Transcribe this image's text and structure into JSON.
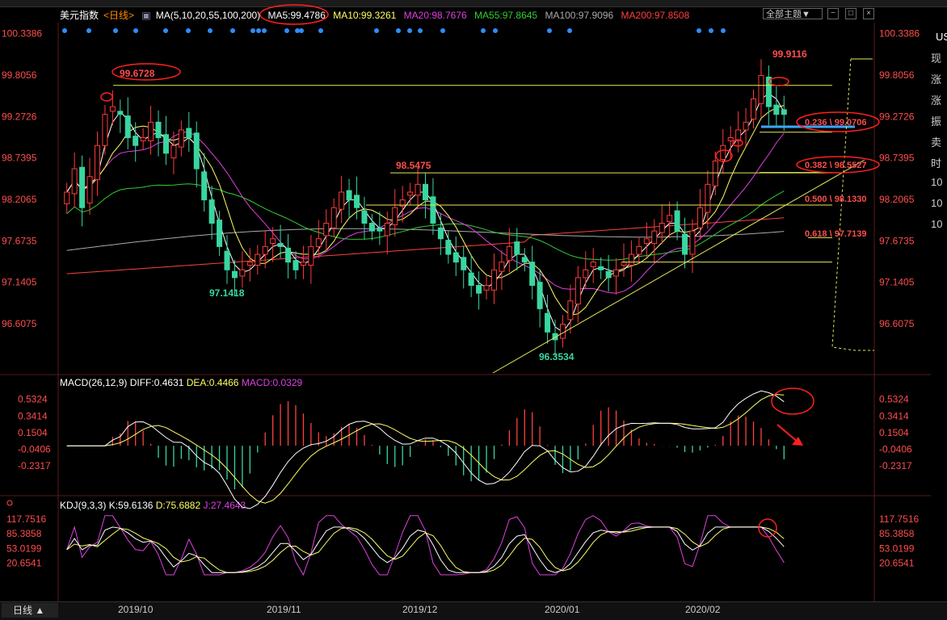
{
  "header": {
    "title": "美元指数",
    "period": "<日线>",
    "ma_label": "MA(5,10,20,55,100,200)",
    "ma5": "MA5:99.4786",
    "ma10": "MA10:99.3261",
    "ma20": "MA20:98.7676",
    "ma55": "MA55:97.8645",
    "ma100": "MA100:97.9096",
    "ma200": "MA200:97.8508",
    "theme": "全部主题▼",
    "colors": {
      "ma5": "#ffffff",
      "ma10": "#ffff66",
      "ma20": "#e040e0",
      "ma55": "#33cc33",
      "ma100": "#aaaaaa",
      "ma200": "#ff4040"
    }
  },
  "side_labels": [
    "现",
    "涨",
    "涨",
    "振",
    "卖",
    "时",
    "10",
    "10",
    "10"
  ],
  "side_top": "US",
  "macd": {
    "label": "MACD(26,12,9)",
    "diff": "DIFF:0.4631",
    "dea": "DEA:0.4466",
    "macd": "MACD:0.0329"
  },
  "kdj": {
    "label": "KDJ(9,3,3)",
    "k": "K:59.6136",
    "d": "D:75.6882",
    "j": "J:27.4643"
  },
  "bottom": {
    "tab": "日线 ▲",
    "dates": [
      "2019/10",
      "2019/11",
      "2019/12",
      "2020/01",
      "2020/02"
    ]
  },
  "chart_data": [
    {
      "type": "candlestick",
      "title": "美元指数 日线",
      "y_ticks": [
        "100.3386",
        "99.8056",
        "99.2726",
        "98.7395",
        "98.2065",
        "97.6735",
        "97.1405",
        "96.6075"
      ],
      "ylim": [
        96.15,
        100.46
      ],
      "annotations": {
        "high_2019_10": "99.6728",
        "low_2019_10": "97.1418",
        "high_2019_12": "98.5475",
        "low_2019_12": "96.3534",
        "high_2020_02": "99.9116",
        "fib": [
          "0.236 \\ 99.0706",
          "0.382 \\ 98.5527",
          "0.500 \\ 98.1330",
          "0.618 \\ 97.7139"
        ]
      },
      "closes": [
        98.3,
        98.6,
        98.1,
        98.5,
        98.9,
        99.3,
        99.4,
        99.3,
        99.0,
        98.9,
        99.0,
        99.2,
        99.0,
        98.8,
        98.9,
        99.1,
        99.0,
        98.6,
        98.2,
        97.9,
        97.6,
        97.3,
        97.2,
        97.3,
        97.4,
        97.5,
        97.6,
        97.7,
        97.6,
        97.4,
        97.3,
        97.4,
        97.6,
        97.7,
        97.9,
        98.1,
        98.3,
        98.2,
        98.1,
        97.9,
        97.8,
        97.8,
        97.9,
        98.1,
        98.2,
        98.3,
        98.4,
        98.2,
        97.9,
        97.7,
        97.5,
        97.4,
        97.3,
        97.1,
        97.0,
        97.1,
        97.3,
        97.4,
        97.6,
        97.5,
        97.4,
        97.1,
        96.8,
        96.5,
        96.4,
        96.6,
        96.9,
        97.2,
        97.3,
        97.4,
        97.3,
        97.2,
        97.3,
        97.4,
        97.5,
        97.6,
        97.7,
        97.8,
        97.9,
        98.0,
        97.8,
        97.5,
        97.8,
        98.1,
        98.4,
        98.7,
        98.9,
        99.0,
        99.1,
        99.2,
        99.5,
        99.8,
        99.4,
        99.3,
        99.3
      ]
    },
    {
      "type": "macd",
      "y_ticks": [
        "0.5324",
        "0.3414",
        "0.1504",
        "-0.0406",
        "-0.2317"
      ],
      "ylim": [
        -0.35,
        0.64
      ]
    },
    {
      "type": "kdj",
      "y_ticks": [
        "117.7516",
        "85.3858",
        "53.0199",
        "20.6541"
      ],
      "ylim": [
        -5,
        130
      ]
    }
  ]
}
